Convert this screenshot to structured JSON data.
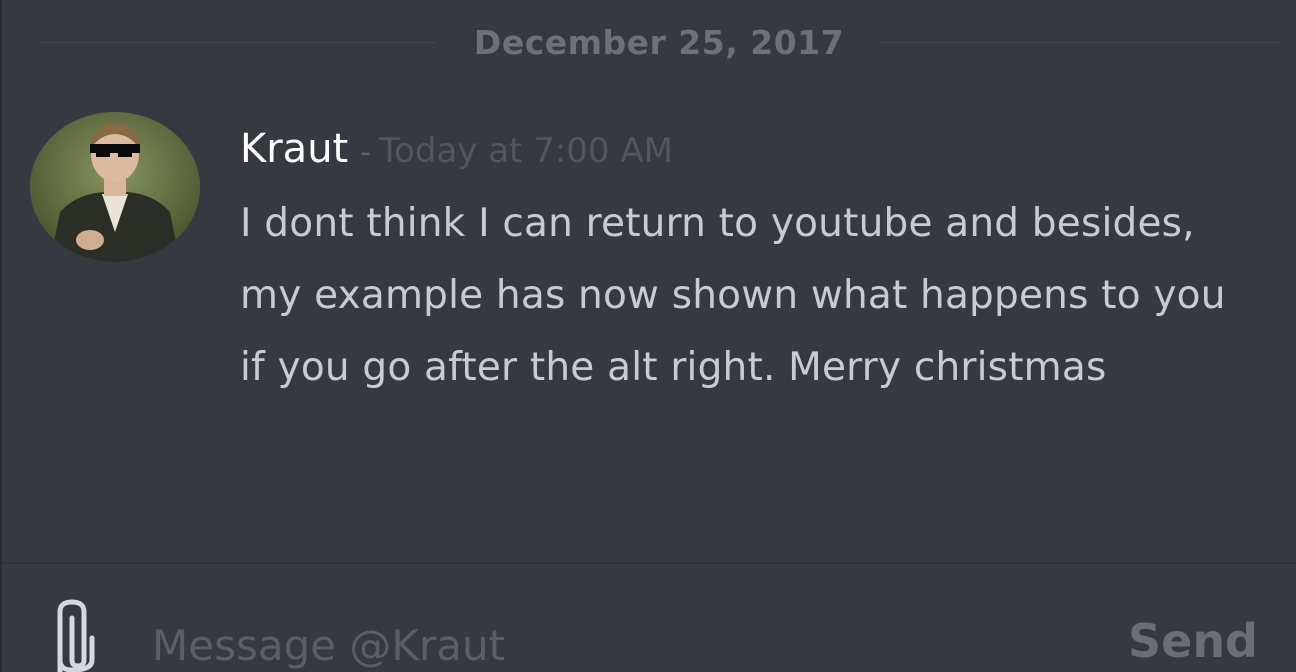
{
  "chat": {
    "date_divider": "December 25, 2017",
    "message": {
      "author": "Kraut",
      "separator": "-",
      "timestamp": "Today at 7:00 AM",
      "text": "I dont think I can return to youtube and besides, my example has now shown what happens to you if you go after the alt right. Merry christmas"
    }
  },
  "composer": {
    "placeholder": "Message @Kraut",
    "value": "",
    "send_label": "Send",
    "attach_icon": "paperclip-icon"
  },
  "colors": {
    "background": "#36393f",
    "username": "#ffffff",
    "message_text": "#c9cbcf",
    "muted": "#53565c"
  }
}
